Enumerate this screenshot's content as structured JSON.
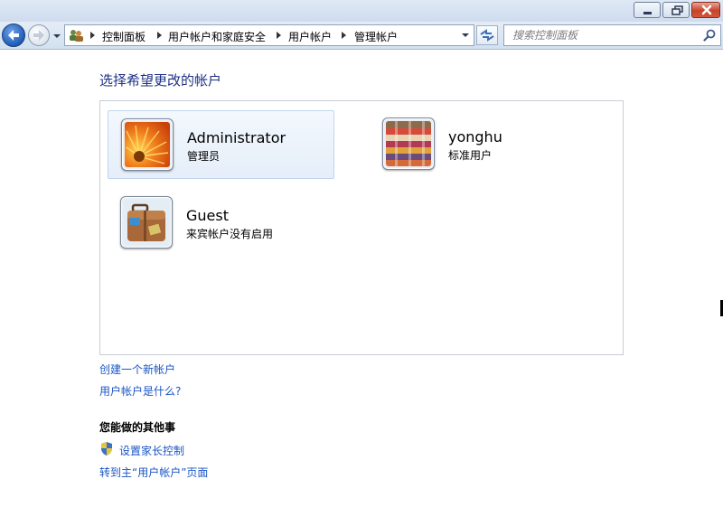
{
  "window": {
    "minimize_label": "",
    "maximize_label": "",
    "close_label": ""
  },
  "breadcrumb": [
    {
      "label": "控制面板"
    },
    {
      "label": "用户帐户和家庭安全"
    },
    {
      "label": "用户帐户"
    },
    {
      "label": "管理帐户"
    }
  ],
  "search": {
    "placeholder": "搜索控制面板"
  },
  "main": {
    "title": "选择希望更改的帐户",
    "accounts": [
      {
        "name": "Administrator",
        "role": "管理员",
        "picture_icon": "flower-picture-icon"
      },
      {
        "name": "yonghu",
        "role": "标准用户",
        "picture_icon": "cloth-texture-picture-icon"
      },
      {
        "name": "Guest",
        "role": "来宾帐户没有启用",
        "picture_icon": "suitcase-picture-icon"
      }
    ],
    "links": {
      "create_account": "创建一个新帐户",
      "what_is_account": "用户帐户是什么?"
    },
    "other_heading": "您能做的其他事",
    "other_links": {
      "parental_controls": "设置家长控制",
      "goto_main": "转到主“用户帐户”页面"
    }
  },
  "colors": {
    "link": "#1a56c5",
    "title": "#1e3287"
  }
}
